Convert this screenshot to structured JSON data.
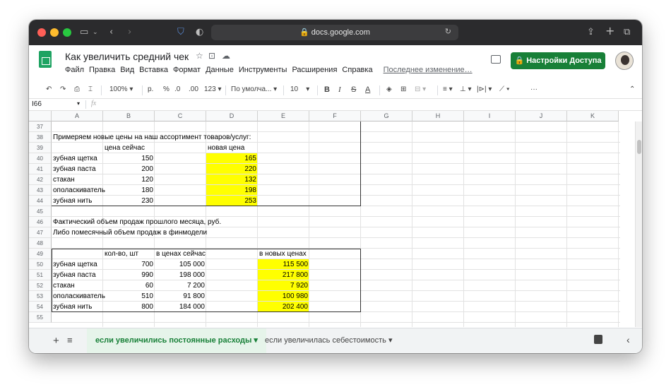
{
  "browser": {
    "url": "docs.google.com"
  },
  "doc": {
    "title": "Как увеличить средний чек",
    "menu": [
      "Файл",
      "Правка",
      "Вид",
      "Вставка",
      "Формат",
      "Данные",
      "Инструменты",
      "Расширения",
      "Справка"
    ],
    "last_edit": "Последнее изменение…",
    "share_label": "Настройки Доступа",
    "share_color": "#188038"
  },
  "toolbar": {
    "zoom": "100%",
    "currency": "р.",
    "percent": "%",
    "dec_dec": ".0",
    "dec_inc": ".00",
    "format": "123",
    "font": "По умолча...",
    "font_size": "10",
    "more": "···"
  },
  "formula_bar": {
    "cell_ref": "I66",
    "fx": "fx",
    "value": ""
  },
  "grid": {
    "columns": [
      "A",
      "B",
      "C",
      "D",
      "E",
      "F",
      "G",
      "H",
      "I",
      "J",
      "K"
    ],
    "rows": [
      {
        "n": "37",
        "cells": {}
      },
      {
        "n": "38",
        "cells": {
          "A": "Примеряем новые цены на наш ассортимент товаров/услуг:"
        }
      },
      {
        "n": "39",
        "cells": {
          "B": "цена сейчас",
          "D": "новая цена"
        }
      },
      {
        "n": "40",
        "cells": {
          "A": "зубная щетка",
          "B": "150",
          "D": "165"
        }
      },
      {
        "n": "41",
        "cells": {
          "A": "зубная паста",
          "B": "200",
          "D": "220"
        }
      },
      {
        "n": "42",
        "cells": {
          "A": "стакан",
          "B": "120",
          "D": "132"
        }
      },
      {
        "n": "43",
        "cells": {
          "A": "ополаскиватель",
          "B": "180",
          "D": "198"
        }
      },
      {
        "n": "44",
        "cells": {
          "A": "зубная нить",
          "B": "230",
          "D": "253"
        }
      },
      {
        "n": "45",
        "cells": {}
      },
      {
        "n": "46",
        "cells": {
          "A": "Фактический объем продаж прошлого месяца, руб."
        }
      },
      {
        "n": "47",
        "cells": {
          "A": "Либо помесячный объем продаж в финмодели"
        }
      },
      {
        "n": "48",
        "cells": {}
      },
      {
        "n": "49",
        "cells": {
          "B": "кол-во, шт",
          "C": "в ценах сейчас",
          "E": "в новых ценах"
        }
      },
      {
        "n": "50",
        "cells": {
          "A": "зубная щетка",
          "B": "700",
          "C": "105 000",
          "E": "115 500"
        }
      },
      {
        "n": "51",
        "cells": {
          "A": "зубная паста",
          "B": "990",
          "C": "198 000",
          "E": "217 800"
        }
      },
      {
        "n": "52",
        "cells": {
          "A": "стакан",
          "B": "60",
          "C": "7 200",
          "E": "7 920"
        }
      },
      {
        "n": "53",
        "cells": {
          "A": "ополаскиватель",
          "B": "510",
          "C": "91 800",
          "E": "100 980"
        }
      },
      {
        "n": "54",
        "cells": {
          "A": "зубная нить",
          "B": "800",
          "C": "184 000",
          "E": "202 400"
        }
      },
      {
        "n": "55",
        "cells": {}
      }
    ],
    "highlight_color": "#ffff00"
  },
  "sheets": {
    "tabs": [
      {
        "label": "если увеличились постоянные расходы",
        "active": true
      },
      {
        "label": "если увеличилась себестоимость",
        "active": false
      }
    ]
  }
}
